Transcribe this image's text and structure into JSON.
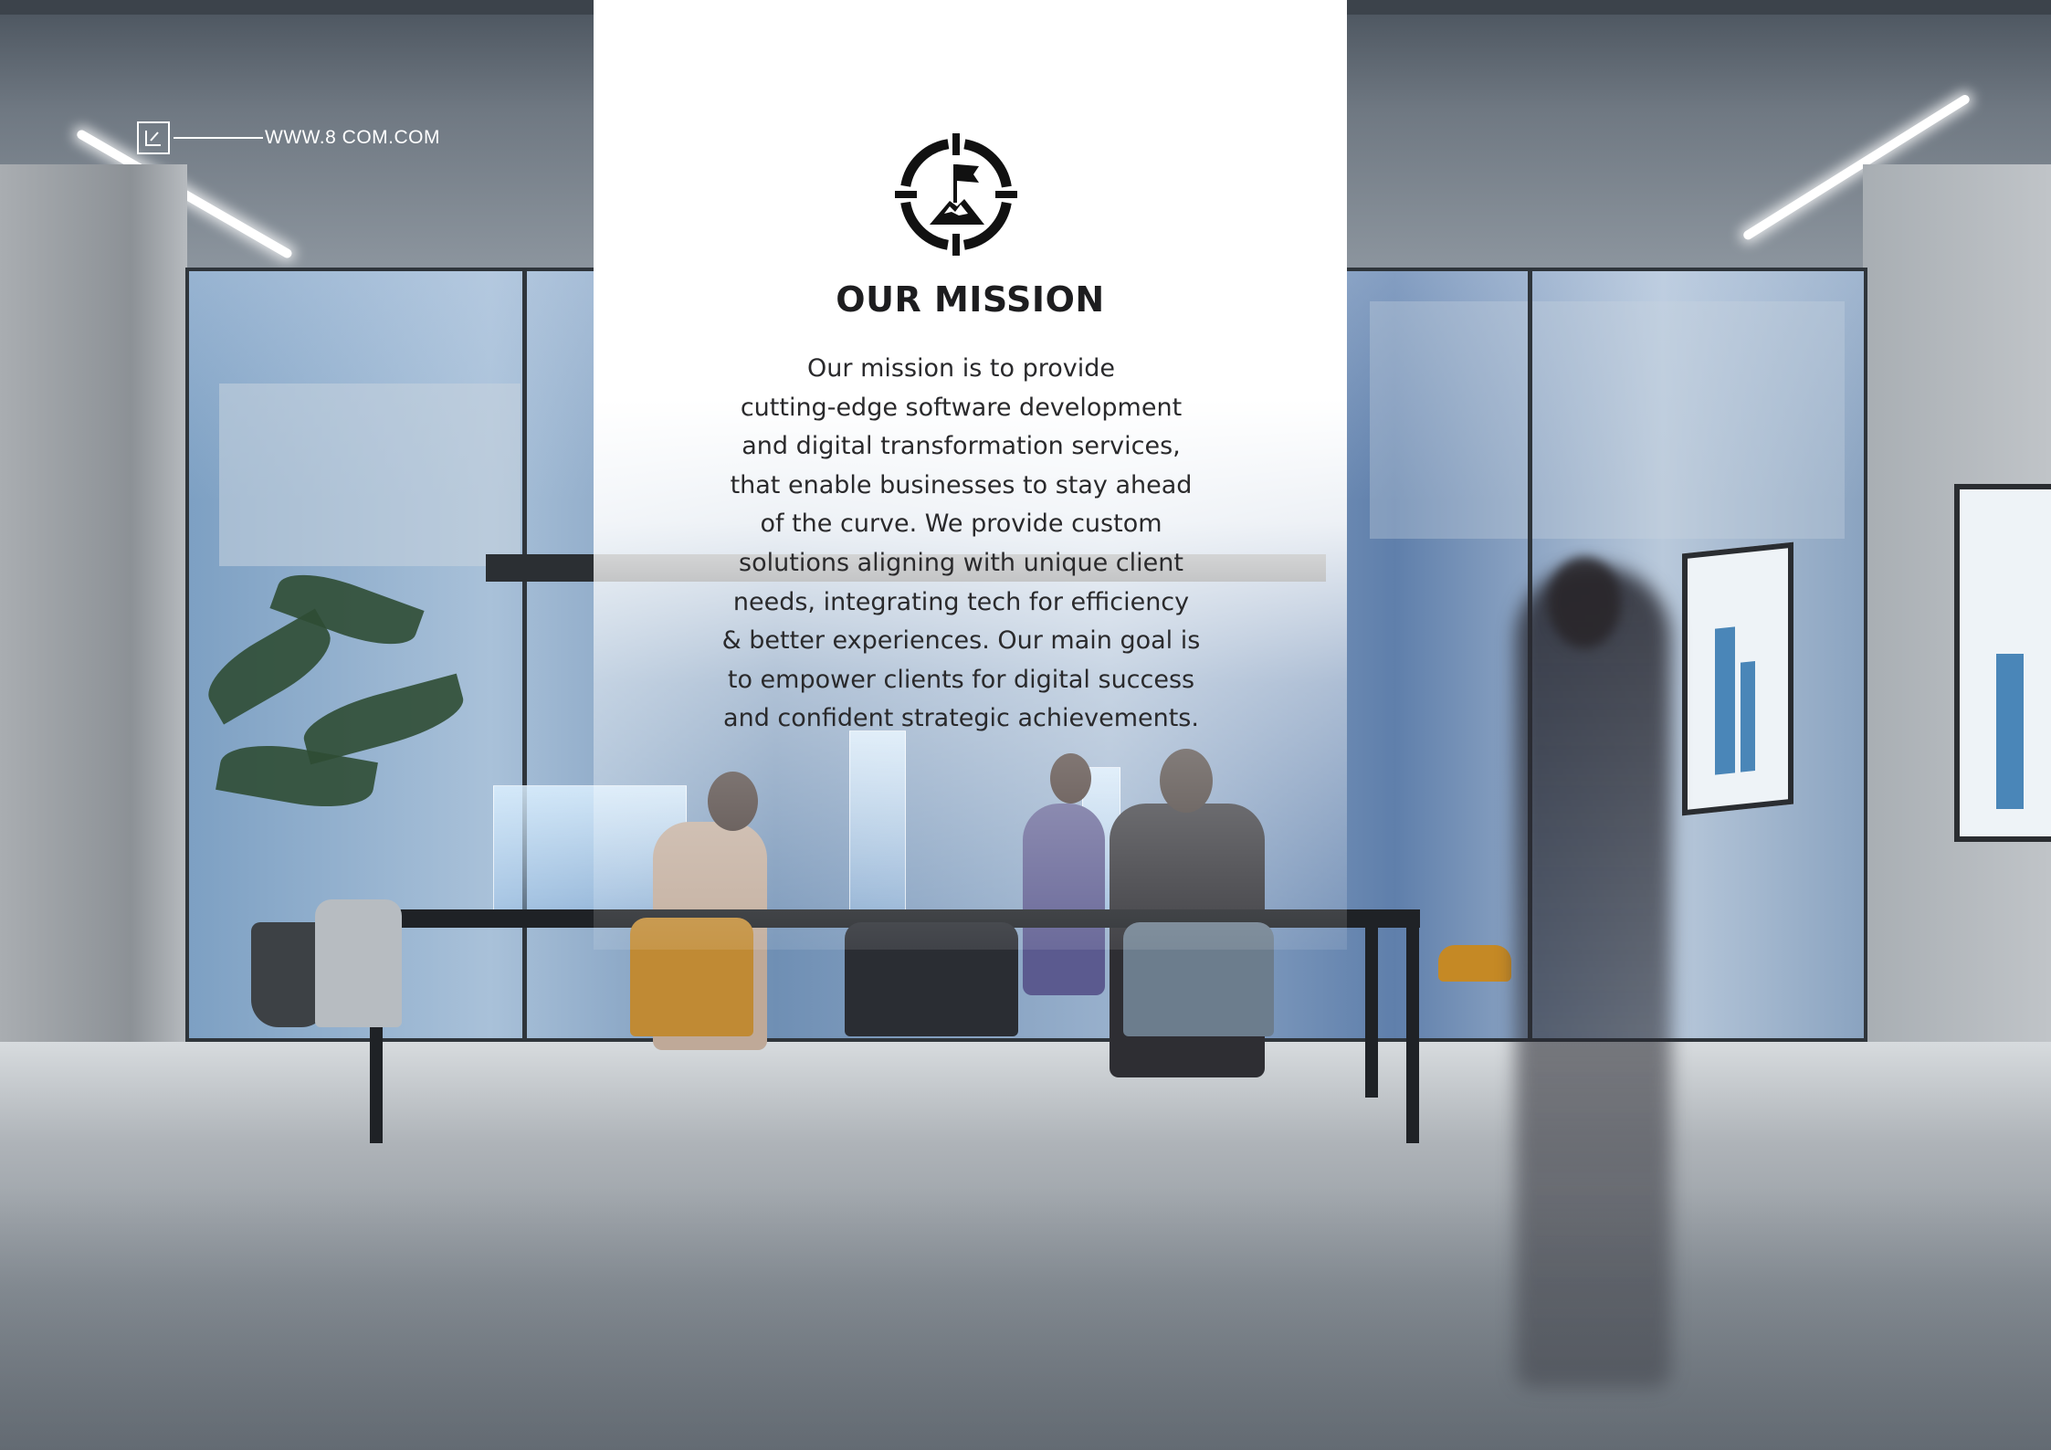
{
  "header": {
    "url": "WWW.8 COM.COM"
  },
  "mission": {
    "title": "OUR MISSION",
    "icon": "target-flag-mountain-icon",
    "body_lines": [
      "Our mission is to provide",
      "cutting-edge software development",
      "and digital transformation services,",
      "that enable businesses to stay ahead",
      "of the curve. We provide custom",
      "solutions aligning with unique client",
      "needs, integrating tech for efficiency",
      "& better experiences. Our main goal is",
      "to empower clients for digital success",
      "and confident strategic achievements."
    ]
  },
  "colors": {
    "panel_background": "#ffffff",
    "title_text": "#1d1d1f",
    "body_text": "#2a2a2c",
    "header_text": "#ffffff"
  }
}
